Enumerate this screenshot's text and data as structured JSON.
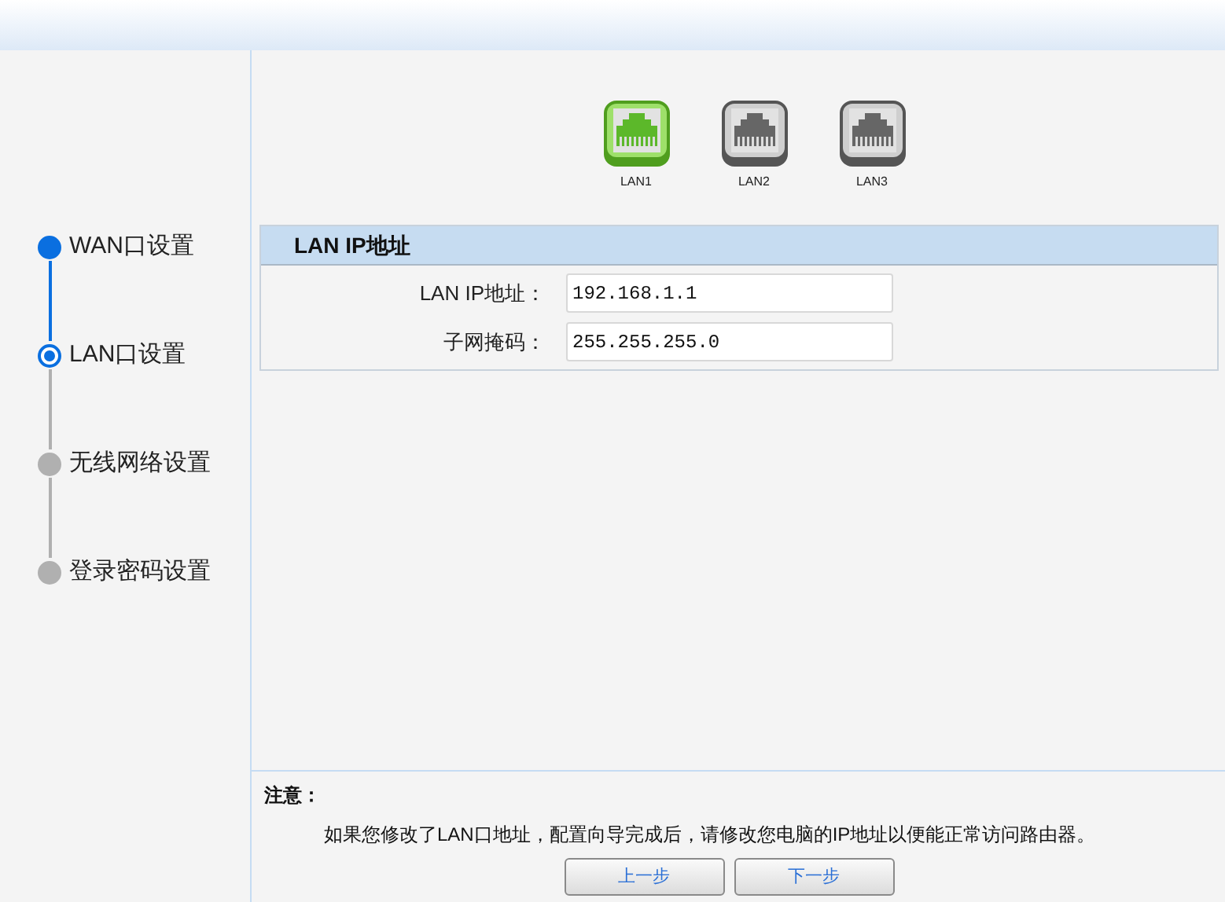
{
  "steps": [
    {
      "label": "WAN口设置",
      "kind": "done"
    },
    {
      "label": "LAN口设置",
      "kind": "current"
    },
    {
      "label": "无线网络设置",
      "kind": "pending"
    },
    {
      "label": "登录密码设置",
      "kind": "pending"
    }
  ],
  "ports": [
    {
      "label": "LAN1",
      "selected": true
    },
    {
      "label": "LAN2",
      "selected": false
    },
    {
      "label": "LAN3",
      "selected": false
    }
  ],
  "section": {
    "title": "LAN IP地址",
    "fields": [
      {
        "label": "LAN IP地址：",
        "value": "192.168.1.1"
      },
      {
        "label": "子网掩码：",
        "value": "255.255.255.0"
      }
    ]
  },
  "note": {
    "title": "注意：",
    "text": "如果您修改了LAN口地址，配置向导完成后，请修改您电脑的IP地址以便能正常访问路由器。"
  },
  "buttons": [
    "上一步",
    "下一步"
  ]
}
